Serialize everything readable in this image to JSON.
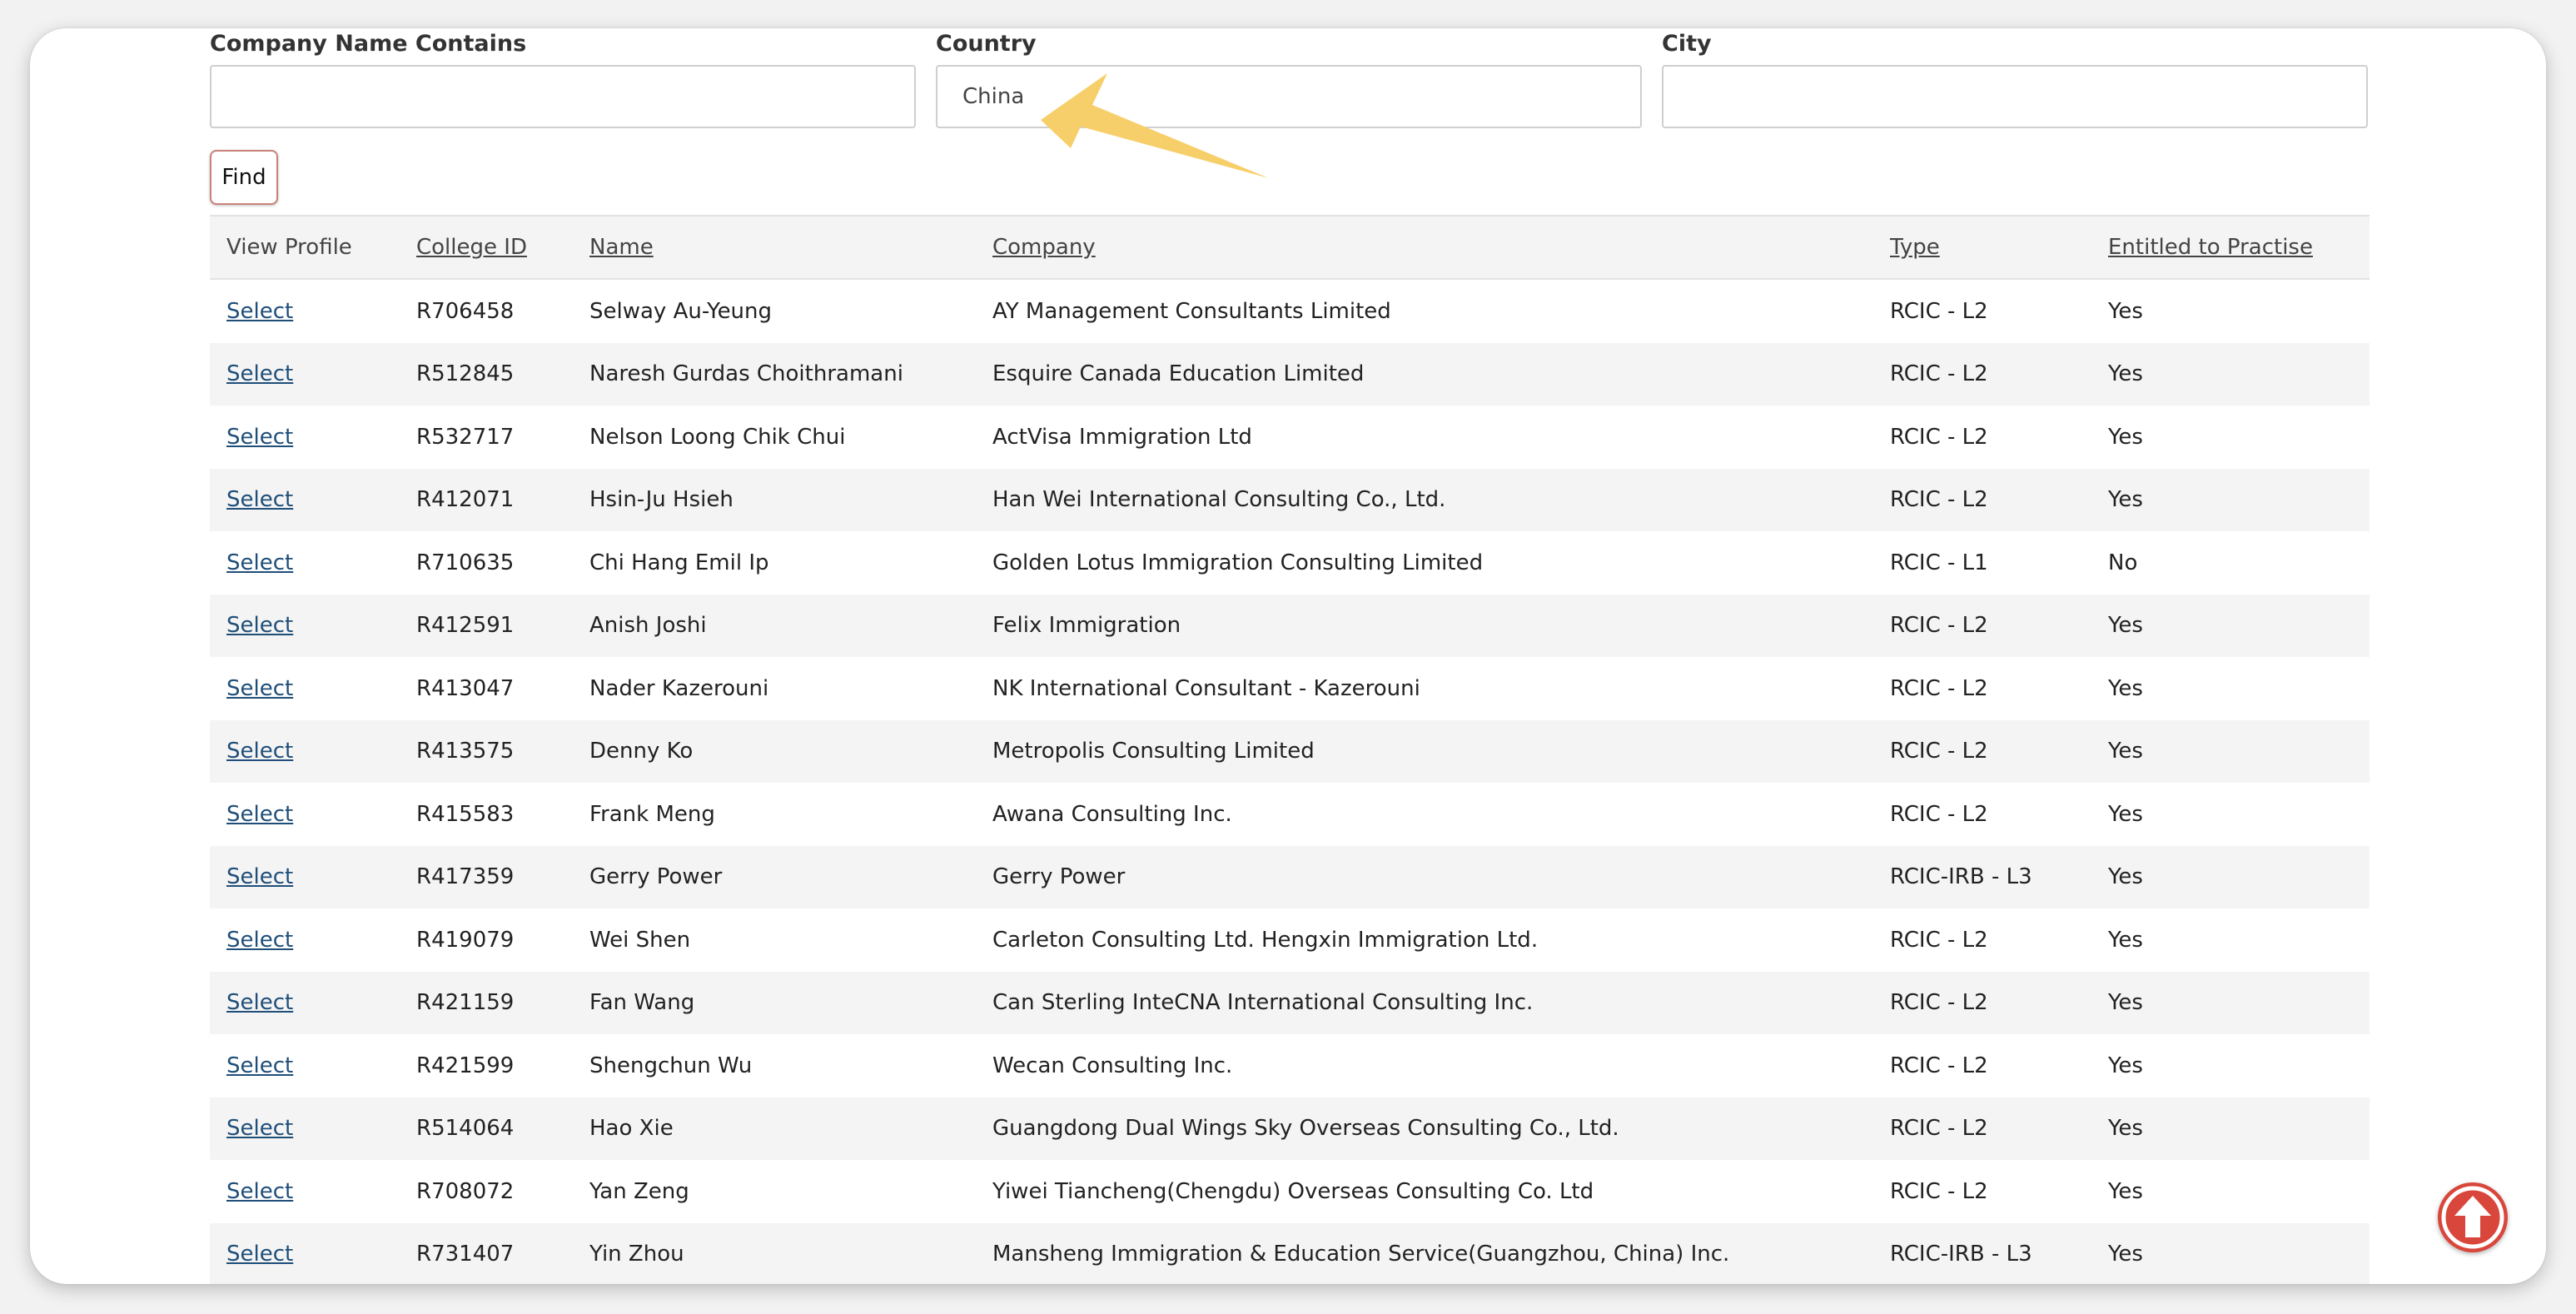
{
  "filters": {
    "company_label": "Company Name Contains",
    "company_value": "",
    "country_label": "Country",
    "country_value": "China",
    "city_label": "City",
    "city_value": ""
  },
  "find_label": "Find",
  "table": {
    "headers": [
      "View Profile",
      "College ID",
      "Name",
      "Company",
      "Type",
      "Entitled to Practise"
    ],
    "rows": [
      {
        "action": "Select",
        "id": "R706458",
        "name": "Selway Au-Yeung",
        "company": "AY Management Consultants Limited",
        "type": "RCIC - L2",
        "entitled": "Yes"
      },
      {
        "action": "Select",
        "id": "R512845",
        "name": "Naresh Gurdas Choithramani",
        "company": "Esquire Canada Education Limited",
        "type": "RCIC - L2",
        "entitled": "Yes"
      },
      {
        "action": "Select",
        "id": "R532717",
        "name": "Nelson Loong Chik Chui",
        "company": "ActVisa Immigration Ltd",
        "type": "RCIC - L2",
        "entitled": "Yes"
      },
      {
        "action": "Select",
        "id": "R412071",
        "name": "Hsin-Ju Hsieh",
        "company": "Han Wei International Consulting Co., Ltd.",
        "type": "RCIC - L2",
        "entitled": "Yes"
      },
      {
        "action": "Select",
        "id": "R710635",
        "name": "Chi Hang Emil Ip",
        "company": "Golden Lotus Immigration Consulting Limited",
        "type": "RCIC - L1",
        "entitled": "No"
      },
      {
        "action": "Select",
        "id": "R412591",
        "name": "Anish Joshi",
        "company": "Felix Immigration",
        "type": "RCIC - L2",
        "entitled": "Yes"
      },
      {
        "action": "Select",
        "id": "R413047",
        "name": "Nader Kazerouni",
        "company": "NK International Consultant - Kazerouni",
        "type": "RCIC - L2",
        "entitled": "Yes"
      },
      {
        "action": "Select",
        "id": "R413575",
        "name": "Denny Ko",
        "company": "Metropolis Consulting Limited",
        "type": "RCIC - L2",
        "entitled": "Yes"
      },
      {
        "action": "Select",
        "id": "R415583",
        "name": "Frank Meng",
        "company": "Awana Consulting Inc.",
        "type": "RCIC - L2",
        "entitled": "Yes"
      },
      {
        "action": "Select",
        "id": "R417359",
        "name": "Gerry Power",
        "company": "Gerry Power",
        "type": "RCIC-IRB - L3",
        "entitled": "Yes"
      },
      {
        "action": "Select",
        "id": "R419079",
        "name": "Wei Shen",
        "company": "Carleton Consulting Ltd. Hengxin Immigration Ltd.",
        "type": "RCIC - L2",
        "entitled": "Yes"
      },
      {
        "action": "Select",
        "id": "R421159",
        "name": "Fan Wang",
        "company": "Can Sterling InteCNA International Consulting Inc.",
        "type": "RCIC - L2",
        "entitled": "Yes"
      },
      {
        "action": "Select",
        "id": "R421599",
        "name": "Shengchun Wu",
        "company": "Wecan Consulting Inc.",
        "type": "RCIC - L2",
        "entitled": "Yes"
      },
      {
        "action": "Select",
        "id": "R514064",
        "name": "Hao Xie",
        "company": "Guangdong Dual Wings Sky Overseas Consulting Co., Ltd.",
        "type": "RCIC - L2",
        "entitled": "Yes"
      },
      {
        "action": "Select",
        "id": "R708072",
        "name": "Yan Zeng",
        "company": "Yiwei Tiancheng(Chengdu) Overseas Consulting Co. Ltd",
        "type": "RCIC - L2",
        "entitled": "Yes"
      },
      {
        "action": "Select",
        "id": "R731407",
        "name": "Yin Zhou",
        "company": "Mansheng Immigration & Education Service(Guangzhou, China) Inc.",
        "type": "RCIC-IRB - L3",
        "entitled": "Yes"
      }
    ]
  },
  "icons": {
    "scroll_top": "arrow-up-circle-icon",
    "annotation": "annotation-arrow"
  },
  "colors": {
    "link": "#1f4e79",
    "accent_button": "#d9463b",
    "annotation_arrow": "#f7cf6a"
  }
}
